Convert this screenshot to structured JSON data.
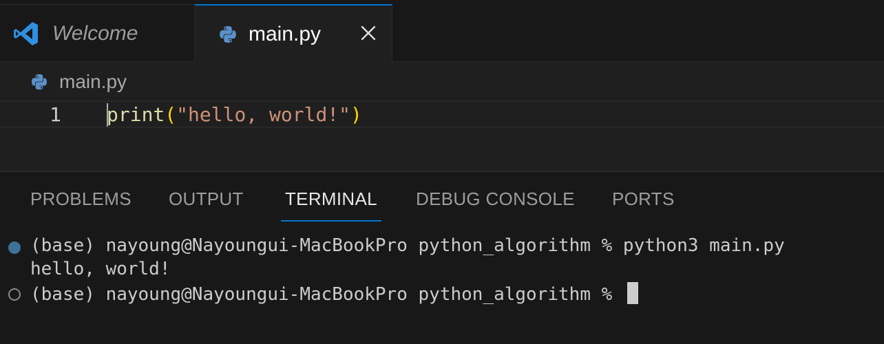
{
  "tabs": [
    {
      "label": "Welcome",
      "icon": "vscode-logo-icon",
      "active": false
    },
    {
      "label": "main.py",
      "icon": "python-icon",
      "active": true
    }
  ],
  "breadcrumb": {
    "label": "main.py",
    "icon": "python-icon"
  },
  "editor": {
    "line_number": "1",
    "code": {
      "fn": "print",
      "open": "(",
      "str": "\"hello, world!\"",
      "close": ")"
    }
  },
  "panel": {
    "tabs": [
      "PROBLEMS",
      "OUTPUT",
      "TERMINAL",
      "DEBUG CONSOLE",
      "PORTS"
    ],
    "active_tab": "TERMINAL"
  },
  "terminal": {
    "line1": "(base) nayoung@Nayoungui-MacBookPro python_algorithm % python3 main.py",
    "line2": "hello, world!",
    "line3": "(base) nayoung@Nayoungui-MacBookPro python_algorithm % "
  },
  "colors": {
    "accent": "#0078d4",
    "background": "#181818",
    "editor_background": "#1f1f1f",
    "string": "#ce9178",
    "function": "#dcdcaa",
    "bracket": "#ffd700"
  }
}
